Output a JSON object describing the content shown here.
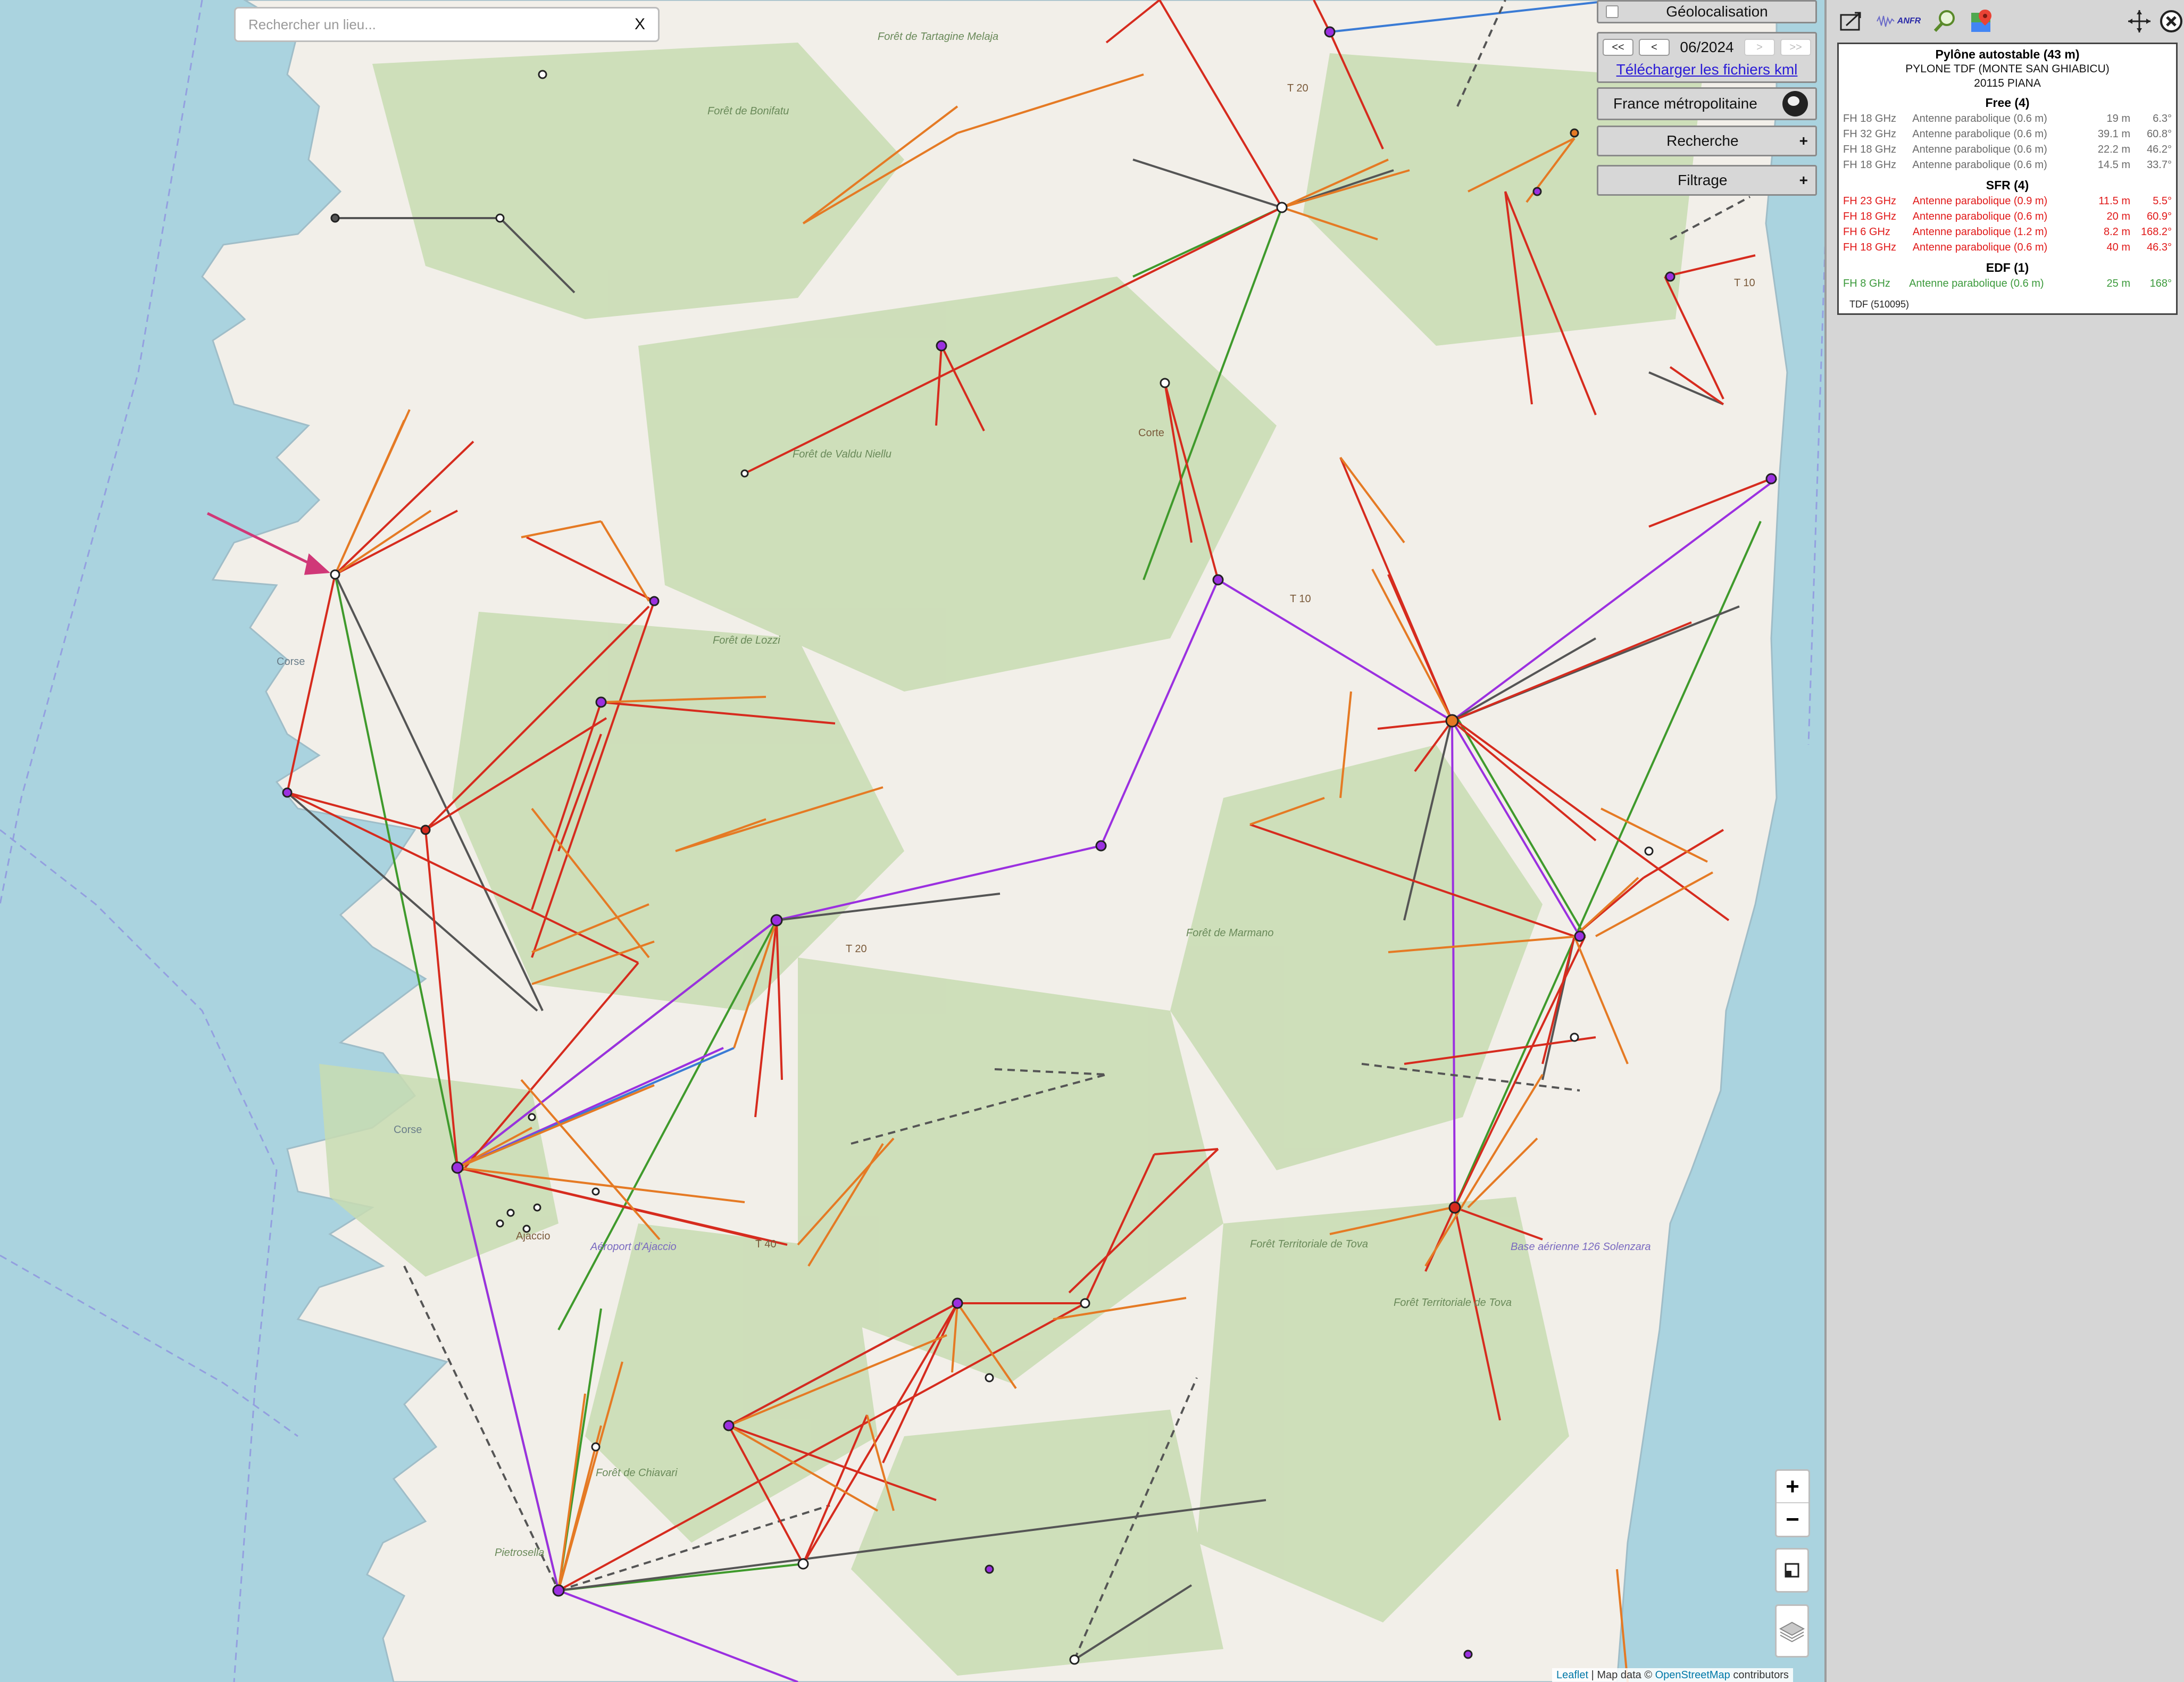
{
  "search": {
    "placeholder": "Rechercher un lieu...",
    "clear_label": "X"
  },
  "geolocation": {
    "label": "Géolocalisation",
    "checked": false
  },
  "period": {
    "first_label": "<<",
    "prev_label": "<",
    "date": "06/2024",
    "next_label": ">",
    "last_label": ">>",
    "download_label": "Télécharger les fichiers kml"
  },
  "region": {
    "label": "France métropolitaine"
  },
  "recherche": {
    "label": "Recherche",
    "toggle": "+"
  },
  "filtrage": {
    "label": "Filtrage",
    "toggle": "+"
  },
  "zoom": {
    "in_label": "+",
    "out_label": "−"
  },
  "map": {
    "labels": [
      "Forêt de Tartagine Melaja",
      "Forêt de Bonifatu",
      "Forêt de Valdu Niellu",
      "Forêt de Lozzi",
      "Forêt de Marmano",
      "Forêt Territoriale de Tova",
      "Forêt Territoriale de Tova",
      "Forêt de Chiavari",
      "Pietrosella",
      "Aéroport d'Ajaccio",
      "Base aérienne 126 Solenzara",
      "T 20",
      "T 20",
      "T 10",
      "T 10",
      "Corse",
      "Corse",
      "Ajaccio",
      "Corte",
      "T 40"
    ],
    "colors": {
      "water": "#aad3df",
      "land": "#f2efe9",
      "forest": "#c8dcb2",
      "free": "#e57a24",
      "sfr": "#d62b1e",
      "bouygues": "#3a7bd5",
      "orange": "#8a2be2",
      "edf": "#3f9a2c",
      "other": "#555555"
    }
  },
  "attribution": {
    "leaflet": "Leaflet",
    "sep": " | Map data © ",
    "osm": "OpenStreetMap",
    "suffix": " contributors"
  },
  "toolbar": {
    "anfr_label": "ANFR",
    "icons": [
      "export-icon",
      "anfr-logo",
      "zoom-search-icon",
      "google-maps-icon",
      "center-icon",
      "close-icon"
    ]
  },
  "info": {
    "title": "Pylône autostable (43 m)",
    "name": "PYLONE TDF (MONTE SAN GHIABICU)",
    "address": "20115 PIANA",
    "operators": [
      {
        "name": "Free (4)",
        "class": "free",
        "rows": [
          {
            "freq": "FH 18 GHz",
            "antenna": "Antenne parabolique (0.6 m)",
            "height": "19 m",
            "azimuth": "6.3°"
          },
          {
            "freq": "FH 32 GHz",
            "antenna": "Antenne parabolique (0.6 m)",
            "height": "39.1 m",
            "azimuth": "60.8°"
          },
          {
            "freq": "FH 18 GHz",
            "antenna": "Antenne parabolique (0.6 m)",
            "height": "22.2 m",
            "azimuth": "46.2°"
          },
          {
            "freq": "FH 18 GHz",
            "antenna": "Antenne parabolique (0.6 m)",
            "height": "14.5 m",
            "azimuth": "33.7°"
          }
        ]
      },
      {
        "name": "SFR (4)",
        "class": "sfr",
        "rows": [
          {
            "freq": "FH 23 GHz",
            "antenna": "Antenne parabolique (0.9 m)",
            "height": "11.5 m",
            "azimuth": "5.5°"
          },
          {
            "freq": "FH 18 GHz",
            "antenna": "Antenne parabolique (0.6 m)",
            "height": "20 m",
            "azimuth": "60.9°"
          },
          {
            "freq": "FH 6 GHz",
            "antenna": "Antenne parabolique (1.2 m)",
            "height": "8.2 m",
            "azimuth": "168.2°"
          },
          {
            "freq": "FH 18 GHz",
            "antenna": "Antenne parabolique (0.6 m)",
            "height": "40 m",
            "azimuth": "46.3°"
          }
        ]
      },
      {
        "name": "EDF (1)",
        "class": "edf",
        "rows": [
          {
            "freq": "FH 8 GHz",
            "antenna": "Antenne parabolique (0.6 m)",
            "height": "25 m",
            "azimuth": "168°"
          }
        ]
      }
    ],
    "footer": "TDF (510095)"
  }
}
